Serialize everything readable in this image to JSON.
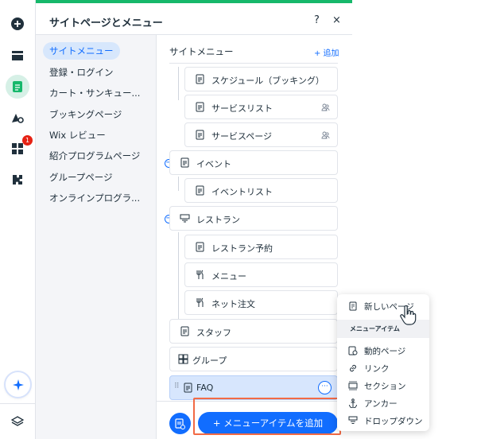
{
  "panel": {
    "title": "サイトページとメニュー",
    "help_label": "?",
    "close_label": "×"
  },
  "nav": {
    "items": [
      {
        "label": "サイトメニュー",
        "active": true
      },
      {
        "label": "登録・ログイン"
      },
      {
        "label": "カート・サンキュー..."
      },
      {
        "label": "ブッキングページ"
      },
      {
        "label": "Wix レビュー"
      },
      {
        "label": "紹介プログラムページ"
      },
      {
        "label": "グループページ"
      },
      {
        "label": "オンラインプログラ..."
      }
    ]
  },
  "content": {
    "title": "サイトメニュー",
    "add_label": "+ 追加",
    "rows": [
      {
        "label": "スケジュール（ブッキング）",
        "icon": "page-icon"
      },
      {
        "label": "サービスリスト",
        "icon": "page-icon",
        "trail": "members-icon"
      },
      {
        "label": "サービスページ",
        "icon": "page-icon",
        "trail": "members-icon"
      },
      {
        "label": "イベント",
        "icon": "page-icon"
      },
      {
        "label": "イベントリスト",
        "icon": "page-icon"
      },
      {
        "label": "レストラン",
        "icon": "dropdown-icon"
      },
      {
        "label": "レストラン予約",
        "icon": "page-icon"
      },
      {
        "label": "メニュー",
        "icon": "fork-knife-icon"
      },
      {
        "label": "ネット注文",
        "icon": "fork-knife-icon"
      },
      {
        "label": "スタッフ",
        "icon": "page-icon"
      },
      {
        "label": "グループ",
        "icon": "groups-icon"
      },
      {
        "label": "FAQ",
        "icon": "page-icon",
        "selected": true
      }
    ],
    "add_menu_item_label": "+ メニューアイテムを追加"
  },
  "popup": {
    "new_page_label": "新しいページ",
    "section_label": "メニューアイテム",
    "items": [
      {
        "label": "動的ページ",
        "icon": "dynamic-page-icon"
      },
      {
        "label": "リンク",
        "icon": "link-icon"
      },
      {
        "label": "セクション",
        "icon": "section-icon"
      },
      {
        "label": "アンカー",
        "icon": "anchor-icon"
      },
      {
        "label": "ドロップダウン",
        "icon": "dropdown-icon"
      }
    ]
  },
  "rail": {
    "badge_count": "1"
  },
  "colors": {
    "accent": "#116dff",
    "brand_green": "#16b86b",
    "highlight": "#f26a45",
    "badge": "#e62214"
  }
}
